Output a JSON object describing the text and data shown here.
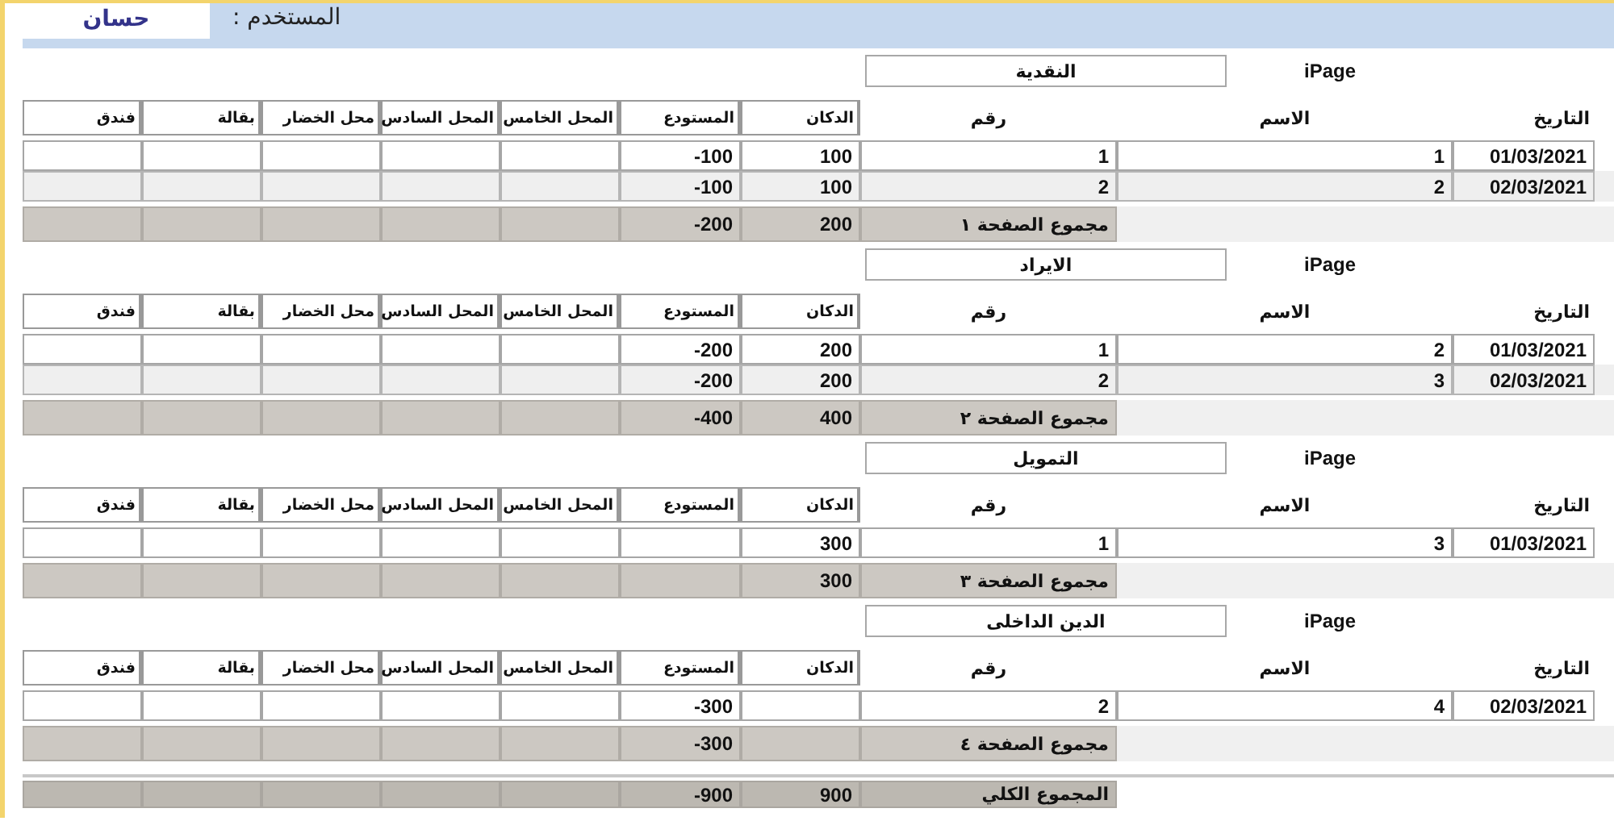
{
  "user": {
    "label": "المستخدم :",
    "value": "حسان"
  },
  "sections": [
    {
      "page_label": "iPage",
      "title": "النقدية",
      "columns": [
        {
          "label": "التاريخ",
          "bordered": false
        },
        {
          "label": "الاسم",
          "bordered": false
        },
        {
          "label": "رقم",
          "bordered": false
        },
        {
          "label": "الدكان",
          "bordered": true
        },
        {
          "label": "المستودع",
          "bordered": true
        },
        {
          "label": "المحل الخامس",
          "bordered": true
        },
        {
          "label": "المحل السادس",
          "bordered": true
        },
        {
          "label": "محل الخضار",
          "bordered": true
        },
        {
          "label": "بقالة",
          "bordered": true
        },
        {
          "label": "فندق",
          "bordered": true
        }
      ],
      "rows": [
        {
          "date": "01/03/2021",
          "name": "1",
          "number": "1",
          "shop": "100",
          "warehouse": "-100"
        },
        {
          "date": "02/03/2021",
          "name": "2",
          "number": "2",
          "shop": "100",
          "warehouse": "-100"
        }
      ],
      "subtotal": {
        "label": "مجموع الصفحة ١",
        "shop": "200",
        "warehouse": "-200"
      }
    },
    {
      "page_label": "iPage",
      "title": "الايراد",
      "columns": [
        {
          "label": "التاريخ",
          "bordered": false
        },
        {
          "label": "الاسم",
          "bordered": false
        },
        {
          "label": "رقم",
          "bordered": false
        },
        {
          "label": "الدكان",
          "bordered": true
        },
        {
          "label": "المستودع",
          "bordered": true
        },
        {
          "label": "المحل الخامس",
          "bordered": true
        },
        {
          "label": "المحل السادس",
          "bordered": true
        },
        {
          "label": "محل الخضار",
          "bordered": true
        },
        {
          "label": "بقالة",
          "bordered": true
        },
        {
          "label": "فندق",
          "bordered": true
        }
      ],
      "rows": [
        {
          "date": "01/03/2021",
          "name": "2",
          "number": "1",
          "shop": "200",
          "warehouse": "-200"
        },
        {
          "date": "02/03/2021",
          "name": "3",
          "number": "2",
          "shop": "200",
          "warehouse": "-200"
        }
      ],
      "subtotal": {
        "label": "مجموع الصفحة ٢",
        "shop": "400",
        "warehouse": "-400"
      }
    },
    {
      "page_label": "iPage",
      "title": "التمويل",
      "columns": [
        {
          "label": "التاريخ",
          "bordered": false
        },
        {
          "label": "الاسم",
          "bordered": false
        },
        {
          "label": "رقم",
          "bordered": false
        },
        {
          "label": "الدكان",
          "bordered": true
        },
        {
          "label": "المستودع",
          "bordered": true
        },
        {
          "label": "المحل الخامس",
          "bordered": true
        },
        {
          "label": "المحل السادس",
          "bordered": true
        },
        {
          "label": "محل الخضار",
          "bordered": true
        },
        {
          "label": "بقالة",
          "bordered": true
        },
        {
          "label": "فندق",
          "bordered": true
        }
      ],
      "rows": [
        {
          "date": "01/03/2021",
          "name": "3",
          "number": "1",
          "shop": "300"
        }
      ],
      "subtotal": {
        "label": "مجموع الصفحة ٣",
        "shop": "300"
      }
    },
    {
      "page_label": "iPage",
      "title": "الدين الداخلى",
      "columns": [
        {
          "label": "التاريخ",
          "bordered": false
        },
        {
          "label": "الاسم",
          "bordered": false
        },
        {
          "label": "رقم",
          "bordered": false
        },
        {
          "label": "الدكان",
          "bordered": true
        },
        {
          "label": "المستودع",
          "bordered": true
        },
        {
          "label": "المحل الخامس",
          "bordered": true
        },
        {
          "label": "المحل السادس",
          "bordered": true
        },
        {
          "label": "محل الخضار",
          "bordered": true
        },
        {
          "label": "بقالة",
          "bordered": true
        },
        {
          "label": "فندق",
          "bordered": true
        }
      ],
      "rows": [
        {
          "date": "02/03/2021",
          "name": "4",
          "number": "2",
          "warehouse": "-300"
        }
      ],
      "subtotal": {
        "label": "مجموع الصفحة ٤",
        "warehouse": "-300"
      }
    }
  ],
  "grand_total": {
    "label": "المجموع الكلي",
    "shop": "900",
    "warehouse": "-900"
  }
}
